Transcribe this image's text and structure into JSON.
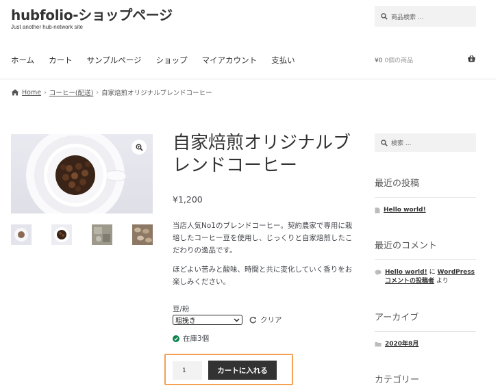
{
  "site": {
    "title": "hubfolio-ショップページ",
    "tagline": "Just another hub-network site"
  },
  "header_search": {
    "placeholder": "商品検索 ..."
  },
  "nav": {
    "items": [
      "ホーム",
      "カート",
      "サンプルページ",
      "ショップ",
      "マイアカウント",
      "支払い"
    ]
  },
  "cart": {
    "amount": "¥0",
    "count_text": "0個の商品"
  },
  "breadcrumb": {
    "home": "Home",
    "category": "コーヒー(配送)",
    "current": "自家焙煎オリジナルブレンドコーヒー",
    "separator": "›"
  },
  "product": {
    "title": "自家焙煎オリジナルブレンドコーヒー",
    "price": "¥1,200",
    "description_1": "当店人気No1のブレンドコーヒー。契約農家で専用に栽培したコーヒー豆を使用し、じっくりと自家焙煎したこだわりの逸品です。",
    "description_2": "ほどよい苦みと酸味、時間と共に変化していく香りをお楽しみください。",
    "variation_label": "豆/粉",
    "variation_selected": "粗挽き",
    "clear_label": "クリア",
    "stock_text": "在庫3個",
    "quantity": "1",
    "add_to_cart_label": "カートに入れる"
  },
  "sidebar": {
    "search_placeholder": "検索 ...",
    "recent_posts_heading": "最近の投稿",
    "recent_post": "Hello world!",
    "recent_comments_heading": "最近のコメント",
    "comment_post": "Hello world!",
    "comment_connector": "に",
    "comment_author": "WordPress コメントの投稿者",
    "comment_suffix": "より",
    "archives_heading": "アーカイブ",
    "archive_item": "2020年8月",
    "categories_heading": "カテゴリー"
  },
  "colors": {
    "button_bg": "#333333",
    "highlight_border": "#f5a052",
    "stock_green": "#0f834d"
  }
}
